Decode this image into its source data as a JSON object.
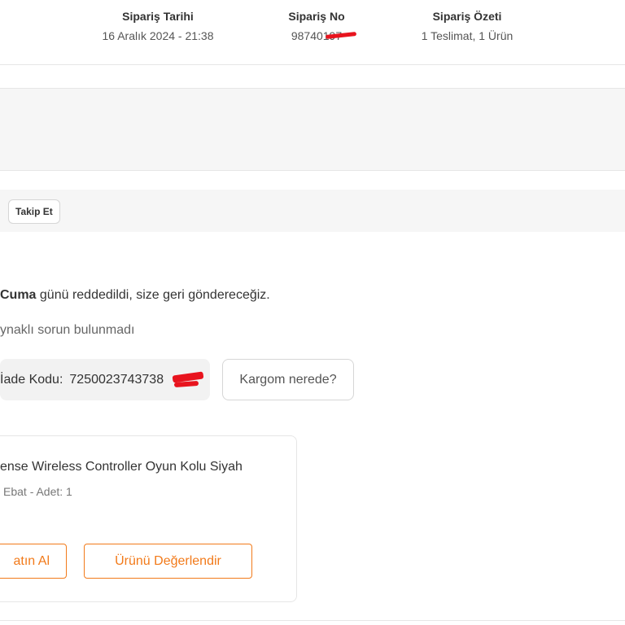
{
  "header": {
    "order_date_title": "Sipariş Tarihi",
    "order_date_value": "16 Aralık 2024 - 21:38",
    "order_no_title": "Sipariş No",
    "order_no_value": "98740197",
    "order_summary_title": "Sipariş Özeti",
    "order_summary_value": "1 Teslimat, 1 Ürün"
  },
  "tracking": {
    "track_button_label": "Takip Et"
  },
  "status": {
    "day": "Cuma",
    "text": " günü reddedildi, size geri göndereceğiz.",
    "sub_text": "ynaklı sorun bulunmadı"
  },
  "return_info": {
    "label": "İade Kodu:",
    "code": "7250023743738",
    "cargo_button_label": "Kargom nerede?"
  },
  "product": {
    "name": "ense Wireless Controller Oyun Kolu Siyah",
    "meta": "Ebat - Adet: 1",
    "buy_again_label": "atın Al",
    "review_label": "Ürünü Değerlendir"
  },
  "colors": {
    "accent": "#f27a1a",
    "redaction": "#e8141e"
  }
}
